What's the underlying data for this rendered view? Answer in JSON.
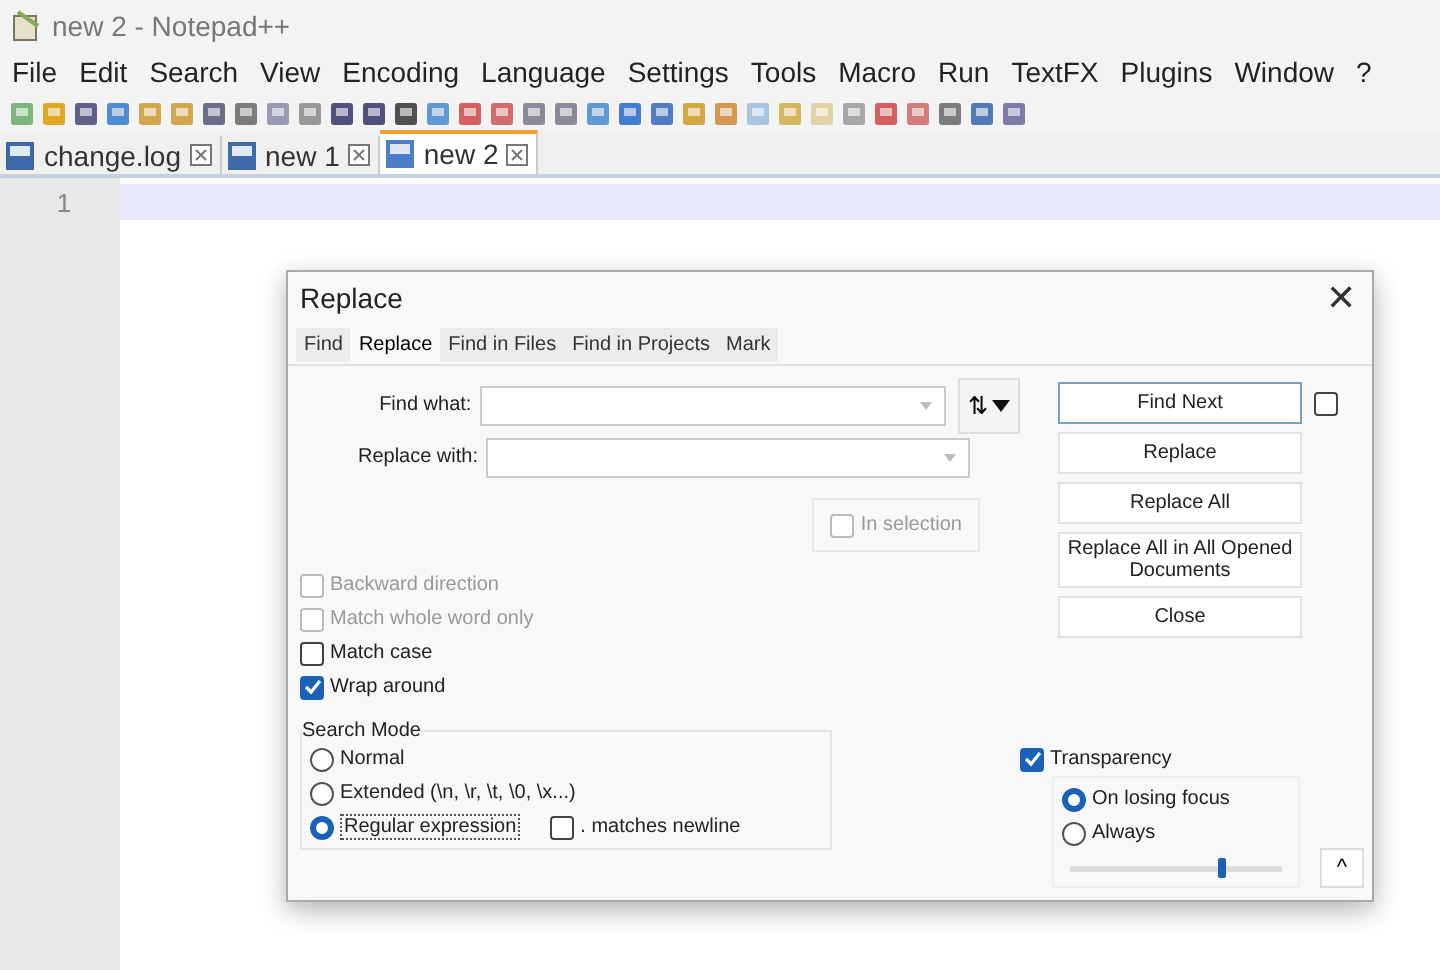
{
  "window": {
    "title": "new 2 - Notepad++"
  },
  "dialog_close": {
    "label": "✕"
  },
  "menu": [
    "File",
    "Edit",
    "Search",
    "View",
    "Encoding",
    "Language",
    "Settings",
    "Tools",
    "Macro",
    "Run",
    "TextFX",
    "Plugins",
    "Window",
    "?"
  ],
  "tabs": [
    {
      "label": "change.log",
      "selected": false
    },
    {
      "label": "new 1",
      "selected": false
    },
    {
      "label": "new 2",
      "selected": true
    }
  ],
  "editor": {
    "line_numbers": [
      "1"
    ]
  },
  "dialog": {
    "title": "Replace",
    "tabs": [
      {
        "label": "Find",
        "selected": false
      },
      {
        "label": "Replace",
        "selected": true
      },
      {
        "label": "Find in Files",
        "selected": false
      },
      {
        "label": "Find in Projects",
        "selected": false
      },
      {
        "label": "Mark",
        "selected": false
      }
    ],
    "fields": [
      {
        "label": "Find what:"
      },
      {
        "label": "Replace with:"
      }
    ],
    "swap": {
      "label": "⇅"
    },
    "in_selection": {
      "label": "In selection",
      "checked": false,
      "disabled": true
    },
    "options": [
      {
        "label": "Backward direction",
        "checked": false,
        "disabled": true
      },
      {
        "label": "Match whole word only",
        "checked": false,
        "disabled": true
      },
      {
        "label": "Match case",
        "checked": false,
        "disabled": false
      },
      {
        "label": "Wrap around",
        "checked": true,
        "disabled": false
      }
    ],
    "search_mode": {
      "title": "Search Mode",
      "modes": [
        {
          "label": "Normal",
          "selected": false
        },
        {
          "label": "Extended (\\n, \\r, \\t, \\0, \\x...)",
          "selected": false
        },
        {
          "label": "Regular expression",
          "selected": true
        }
      ],
      "matches_newline": {
        "label": ". matches newline",
        "checked": false
      }
    },
    "buttons": [
      "Find Next",
      "Replace",
      "Replace All",
      "Replace All in All Opened Documents",
      "Close"
    ],
    "find_next_option": {
      "checked": false
    },
    "transparency": {
      "label": "Transparency",
      "checked": true,
      "modes": [
        {
          "label": "On losing focus",
          "selected": true
        },
        {
          "label": "Always",
          "selected": false
        }
      ],
      "level": 0.72
    },
    "collapse": {
      "label": "^"
    }
  }
}
